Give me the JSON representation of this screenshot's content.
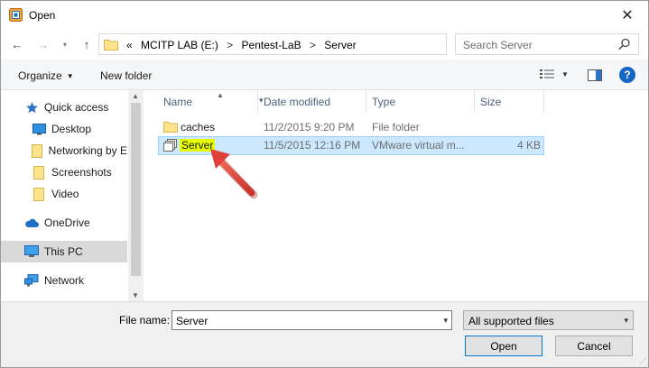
{
  "window": {
    "title": "Open"
  },
  "address": {
    "crumbs": [
      "«",
      "MCITP LAB (E:)",
      "Pentest-LaB",
      "Server"
    ],
    "separator": ">"
  },
  "search": {
    "placeholder": "Search Server"
  },
  "toolbar": {
    "organize_label": "Organize",
    "new_folder_label": "New folder",
    "help_label": "?"
  },
  "sidebar": {
    "items": [
      {
        "label": "Quick access",
        "icon": "star-icon"
      },
      {
        "label": "Desktop",
        "icon": "desktop-icon"
      },
      {
        "label": "Networking by E",
        "icon": "folder-icon"
      },
      {
        "label": "Screenshots",
        "icon": "folder-icon"
      },
      {
        "label": "Video",
        "icon": "folder-icon"
      },
      {
        "label": "OneDrive",
        "icon": "cloud-icon"
      },
      {
        "label": "This PC",
        "icon": "computer-icon"
      },
      {
        "label": "Network",
        "icon": "network-icon"
      }
    ]
  },
  "filelist": {
    "columns": [
      "Name",
      "Date modified",
      "Type",
      "Size"
    ],
    "rows": [
      {
        "name": "caches",
        "date": "11/2/2015 9:20 PM",
        "type": "File folder",
        "size": "",
        "icon": "folder-icon"
      },
      {
        "name": "Server",
        "date": "11/5/2015 12:16 PM",
        "type": "VMware virtual m...",
        "size": "4 KB",
        "icon": "vmware-file-icon"
      }
    ]
  },
  "footer": {
    "filename_label": "File name:",
    "filename_value": "Server",
    "filter_value": "All supported files",
    "open_label": "Open",
    "cancel_label": "Cancel"
  },
  "colors": {
    "selection_bg": "#cce8ff",
    "selection_border": "#99d1ff",
    "highlight": "#e6ff00",
    "annotation_arrow": "#e0403a",
    "help_blue": "#1566c0"
  }
}
